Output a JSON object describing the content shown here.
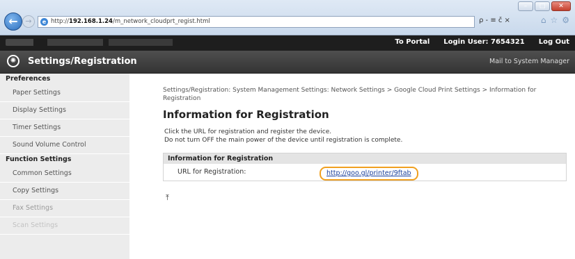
{
  "browser": {
    "url_prefix": "http://",
    "url_host": "192.168.1.24",
    "url_path": "/m_network_cloudprt_regist.html",
    "addr_tools": "ρ - ≡ č ×",
    "icons": [
      "back-arrow",
      "forward-arrow",
      "ie-logo",
      "home-icon",
      "star-icon",
      "gear-icon"
    ]
  },
  "header": {
    "to_portal": "To Portal",
    "login_user_label": "Login User:",
    "login_user_value": "7654321",
    "logout": "Log Out",
    "title": "Settings/Registration",
    "mail": "Mail to System Manager"
  },
  "sidebar": {
    "sections": [
      {
        "heading": "Preferences",
        "items": [
          "Paper Settings",
          "Display Settings",
          "Timer Settings",
          "Sound Volume Control"
        ]
      },
      {
        "heading": "Function Settings",
        "items": [
          "Common Settings",
          "Copy Settings",
          "Fax Settings",
          "Scan Settings"
        ]
      }
    ]
  },
  "main": {
    "breadcrumb": "Settings/Registration: System Management Settings: Network Settings > Google Cloud Print Settings > Information for Registration",
    "title": "Information for Registration",
    "desc_line1": "Click the URL for registration and register the device.",
    "desc_line2": "Do not turn OFF the main power of the device until registration is complete.",
    "table_header": "Information for Registration",
    "url_label": "URL for Registration:",
    "url_value": "http://goo.gl/printer/9ftab",
    "highlight_color": "#f0a020"
  }
}
